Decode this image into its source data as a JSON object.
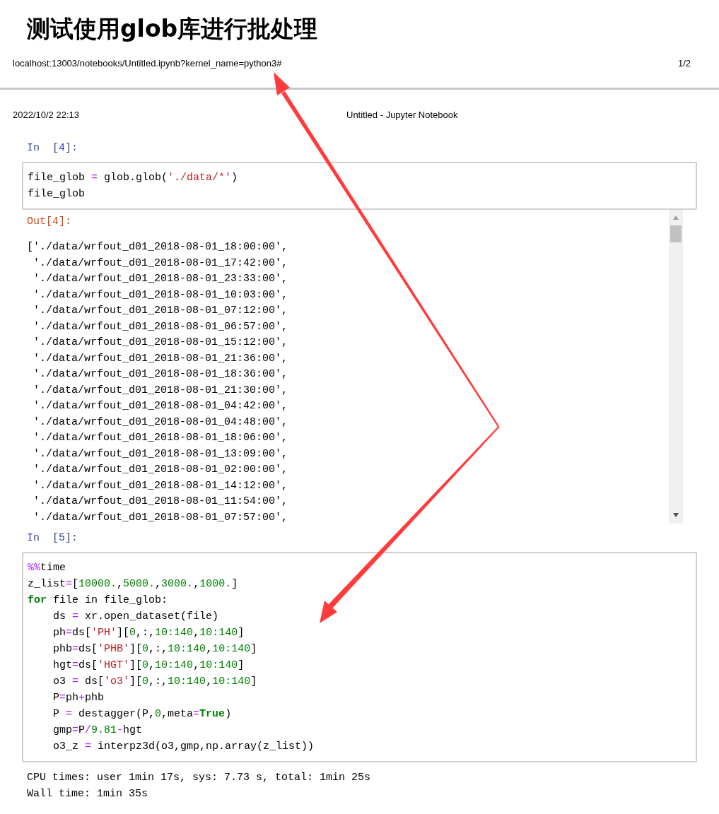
{
  "page_title": "测试使用glob库进行批处理",
  "print_header": {
    "url": "localhost:13003/notebooks/Untitled.ipynb?kernel_name=python3#",
    "page_number": "1/2",
    "date": "2022/10/2 22:13",
    "document_title": "Untitled - Jupyter Notebook"
  },
  "cells": [
    {
      "prompt": "In  [4]:",
      "code": [
        [
          {
            "kind": "plain",
            "text": "file_glob "
          },
          {
            "kind": "op",
            "text": "="
          },
          {
            "kind": "plain",
            "text": " glob.glob("
          },
          {
            "kind": "str",
            "text": "'./data/*'"
          },
          {
            "kind": "plain",
            "text": ")"
          }
        ],
        [
          {
            "kind": "plain",
            "text": "file_glob"
          }
        ]
      ],
      "output_prompt": "Out[4]:",
      "output_lines": [
        "['./data/wrfout_d01_2018-08-01_18:00:00',",
        " './data/wrfout_d01_2018-08-01_17:42:00',",
        " './data/wrfout_d01_2018-08-01_23:33:00',",
        " './data/wrfout_d01_2018-08-01_10:03:00',",
        " './data/wrfout_d01_2018-08-01_07:12:00',",
        " './data/wrfout_d01_2018-08-01_06:57:00',",
        " './data/wrfout_d01_2018-08-01_15:12:00',",
        " './data/wrfout_d01_2018-08-01_21:36:00',",
        " './data/wrfout_d01_2018-08-01_18:36:00',",
        " './data/wrfout_d01_2018-08-01_21:30:00',",
        " './data/wrfout_d01_2018-08-01_04:42:00',",
        " './data/wrfout_d01_2018-08-01_04:48:00',",
        " './data/wrfout_d01_2018-08-01_18:06:00',",
        " './data/wrfout_d01_2018-08-01_13:09:00',",
        " './data/wrfout_d01_2018-08-01_02:00:00',",
        " './data/wrfout_d01_2018-08-01_14:12:00',",
        " './data/wrfout_d01_2018-08-01_11:54:00',",
        " './data/wrfout_d01_2018-08-01_07:57:00',"
      ]
    },
    {
      "prompt": "In  [5]:",
      "code": [
        [
          {
            "kind": "op",
            "text": "%%"
          },
          {
            "kind": "plain",
            "text": "time"
          }
        ],
        [
          {
            "kind": "plain",
            "text": "z_list"
          },
          {
            "kind": "op",
            "text": "="
          },
          {
            "kind": "plain",
            "text": "["
          },
          {
            "kind": "num",
            "text": "10000."
          },
          {
            "kind": "plain",
            "text": ","
          },
          {
            "kind": "num",
            "text": "5000."
          },
          {
            "kind": "plain",
            "text": ","
          },
          {
            "kind": "num",
            "text": "3000."
          },
          {
            "kind": "plain",
            "text": ","
          },
          {
            "kind": "num",
            "text": "1000."
          },
          {
            "kind": "plain",
            "text": "]"
          }
        ],
        [
          {
            "kind": "kw",
            "text": "for"
          },
          {
            "kind": "plain",
            "text": " file in file_glob:"
          }
        ],
        [
          {
            "kind": "plain",
            "text": "    ds "
          },
          {
            "kind": "op",
            "text": "="
          },
          {
            "kind": "plain",
            "text": " xr.open_dataset(file)"
          }
        ],
        [
          {
            "kind": "plain",
            "text": "    ph"
          },
          {
            "kind": "op",
            "text": "="
          },
          {
            "kind": "plain",
            "text": "ds["
          },
          {
            "kind": "str",
            "text": "'PH'"
          },
          {
            "kind": "plain",
            "text": "]["
          },
          {
            "kind": "num",
            "text": "0"
          },
          {
            "kind": "plain",
            "text": ",:,"
          },
          {
            "kind": "num",
            "text": "10:140"
          },
          {
            "kind": "plain",
            "text": ","
          },
          {
            "kind": "num",
            "text": "10:140"
          },
          {
            "kind": "plain",
            "text": "]"
          }
        ],
        [
          {
            "kind": "plain",
            "text": "    phb"
          },
          {
            "kind": "op",
            "text": "="
          },
          {
            "kind": "plain",
            "text": "ds["
          },
          {
            "kind": "str",
            "text": "'PHB'"
          },
          {
            "kind": "plain",
            "text": "]["
          },
          {
            "kind": "num",
            "text": "0"
          },
          {
            "kind": "plain",
            "text": ",:,"
          },
          {
            "kind": "num",
            "text": "10:140"
          },
          {
            "kind": "plain",
            "text": ","
          },
          {
            "kind": "num",
            "text": "10:140"
          },
          {
            "kind": "plain",
            "text": "]"
          }
        ],
        [
          {
            "kind": "plain",
            "text": "    hgt"
          },
          {
            "kind": "op",
            "text": "="
          },
          {
            "kind": "plain",
            "text": "ds["
          },
          {
            "kind": "str",
            "text": "'HGT'"
          },
          {
            "kind": "plain",
            "text": "]["
          },
          {
            "kind": "num",
            "text": "0"
          },
          {
            "kind": "plain",
            "text": ","
          },
          {
            "kind": "num",
            "text": "10:140"
          },
          {
            "kind": "plain",
            "text": ","
          },
          {
            "kind": "num",
            "text": "10:140"
          },
          {
            "kind": "plain",
            "text": "]"
          }
        ],
        [
          {
            "kind": "plain",
            "text": "    o3 "
          },
          {
            "kind": "op",
            "text": "="
          },
          {
            "kind": "plain",
            "text": " ds["
          },
          {
            "kind": "str",
            "text": "'o3'"
          },
          {
            "kind": "plain",
            "text": "]["
          },
          {
            "kind": "num",
            "text": "0"
          },
          {
            "kind": "plain",
            "text": ",:,"
          },
          {
            "kind": "num",
            "text": "10:140"
          },
          {
            "kind": "plain",
            "text": ","
          },
          {
            "kind": "num",
            "text": "10:140"
          },
          {
            "kind": "plain",
            "text": "]"
          }
        ],
        [
          {
            "kind": "plain",
            "text": "    P"
          },
          {
            "kind": "op",
            "text": "="
          },
          {
            "kind": "plain",
            "text": "ph"
          },
          {
            "kind": "op",
            "text": "+"
          },
          {
            "kind": "plain",
            "text": "phb"
          }
        ],
        [
          {
            "kind": "plain",
            "text": "    P "
          },
          {
            "kind": "op",
            "text": "="
          },
          {
            "kind": "plain",
            "text": " destagger(P,"
          },
          {
            "kind": "num",
            "text": "0"
          },
          {
            "kind": "plain",
            "text": ",meta"
          },
          {
            "kind": "op",
            "text": "="
          },
          {
            "kind": "kw",
            "text": "True"
          },
          {
            "kind": "plain",
            "text": ")"
          }
        ],
        [
          {
            "kind": "plain",
            "text": "    gmp"
          },
          {
            "kind": "op",
            "text": "="
          },
          {
            "kind": "plain",
            "text": "P"
          },
          {
            "kind": "op",
            "text": "/"
          },
          {
            "kind": "num",
            "text": "9.81"
          },
          {
            "kind": "op",
            "text": "-"
          },
          {
            "kind": "plain",
            "text": "hgt"
          }
        ],
        [
          {
            "kind": "plain",
            "text": "    o3_z "
          },
          {
            "kind": "op",
            "text": "="
          },
          {
            "kind": "plain",
            "text": " interpz3d(o3,gmp,np.array(z_list))"
          }
        ]
      ],
      "stream_lines": [
        "CPU times: user 1min 17s, sys: 7.73 s, total: 1min 25s",
        "Wall time: 1min 35s"
      ]
    }
  ]
}
